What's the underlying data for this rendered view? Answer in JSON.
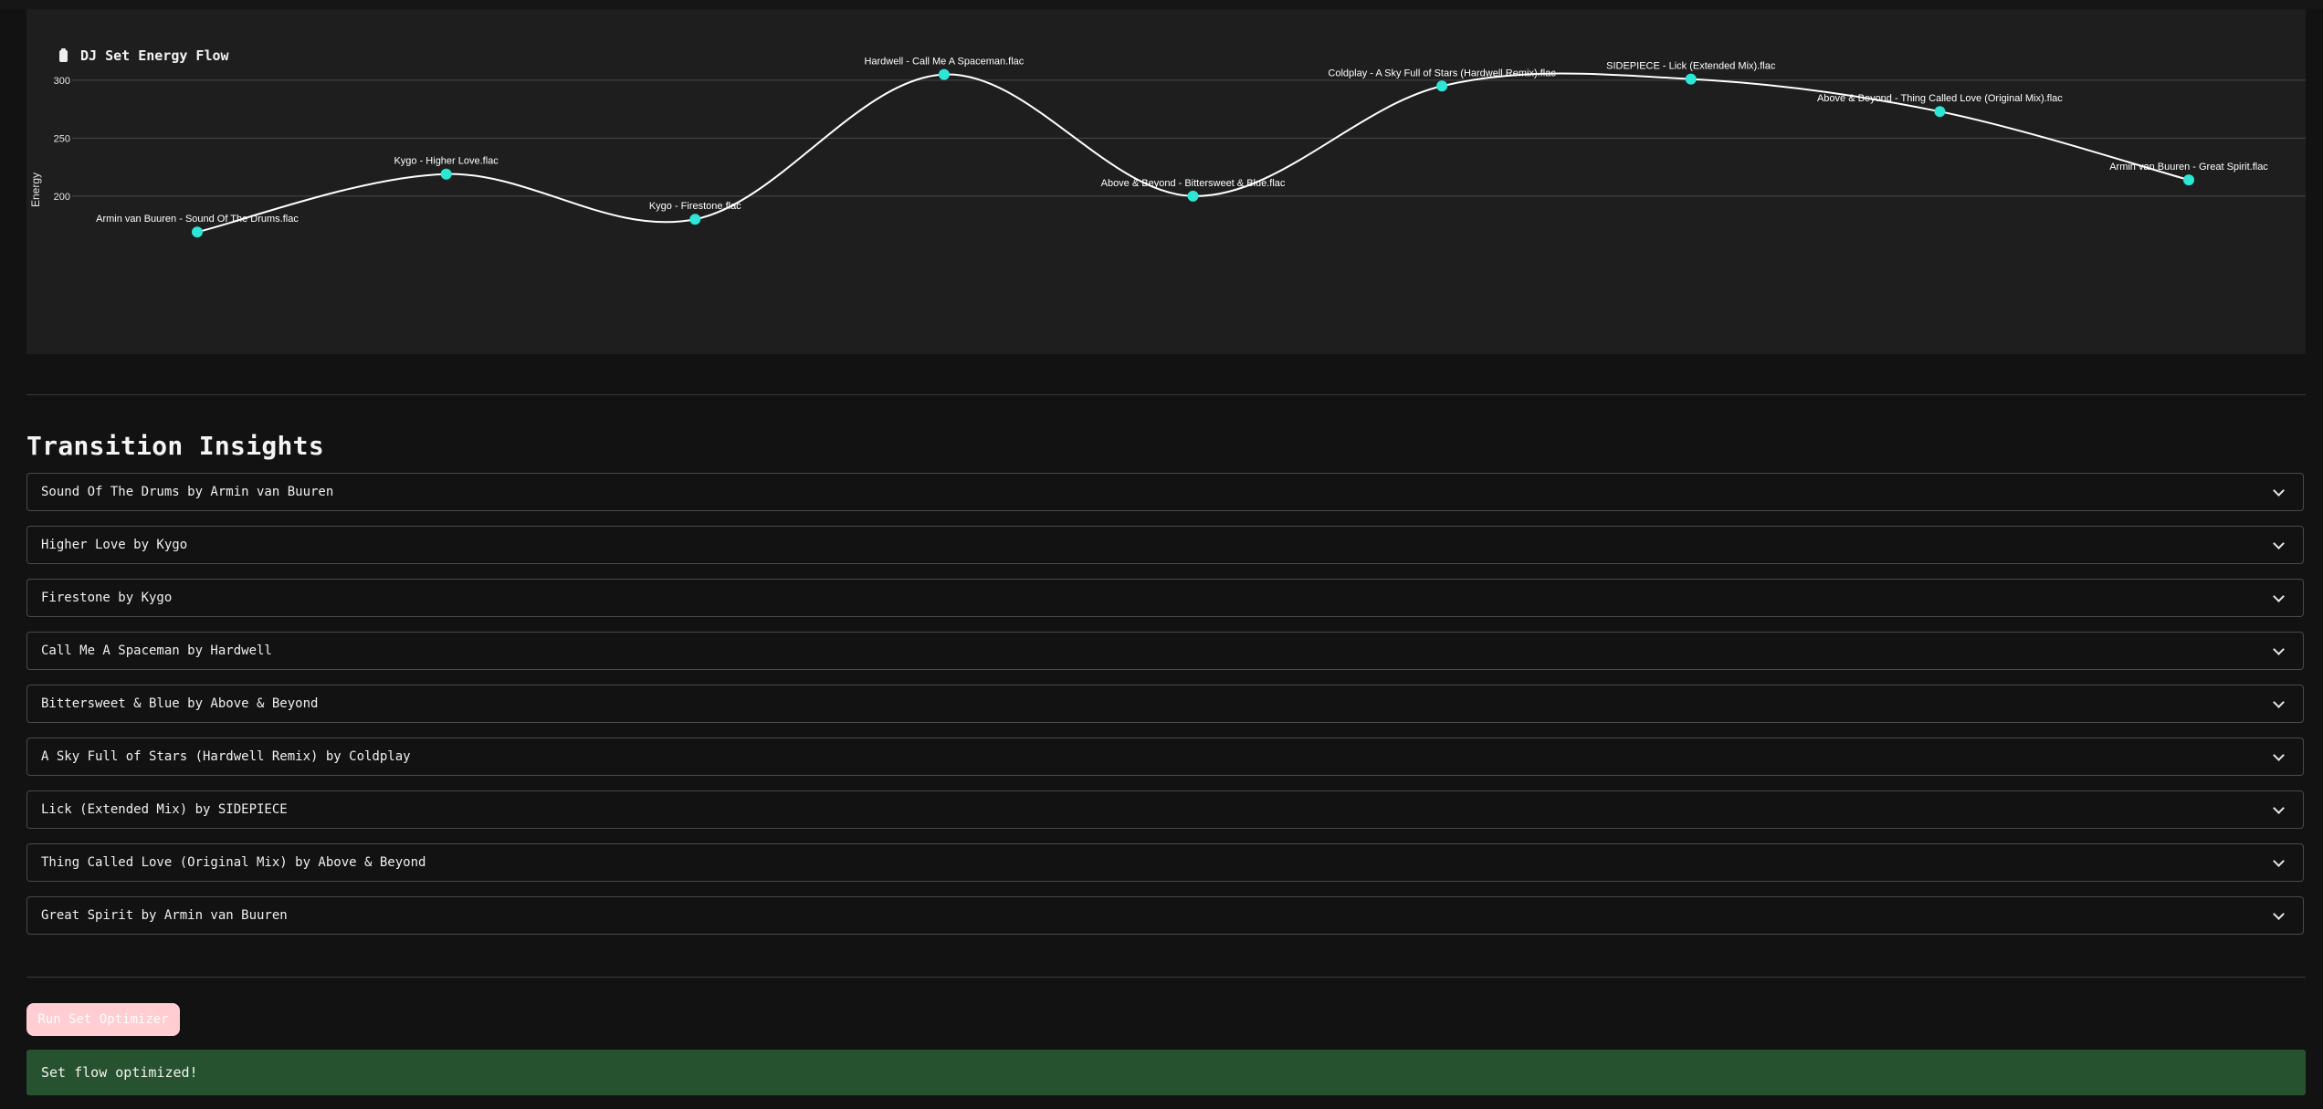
{
  "chart": {
    "title": "DJ Set Energy Flow",
    "title_icon": "clipboard-icon"
  },
  "chart_data": {
    "type": "line",
    "title": "DJ Set Energy Flow",
    "xlabel": "",
    "ylabel": "Energy",
    "yticks": [
      200,
      250,
      300
    ],
    "ylim": [
      140,
      322
    ],
    "grid": true,
    "curve": "smooth",
    "line_color": "#ffffff",
    "marker_color": "#2de6d6",
    "points": [
      {
        "label": "Armin van Buuren - Sound Of The Drums.flac",
        "y": 169
      },
      {
        "label": "Kygo - Higher Love.flac",
        "y": 219
      },
      {
        "label": "Kygo - Firestone.flac",
        "y": 180
      },
      {
        "label": "Hardwell - Call Me A Spaceman.flac",
        "y": 305
      },
      {
        "label": "Above & Beyond - Bittersweet & Blue.flac",
        "y": 200
      },
      {
        "label": "Coldplay - A Sky Full of Stars (Hardwell Remix).flac",
        "y": 295
      },
      {
        "label": "SIDEPIECE - Lick (Extended Mix).flac",
        "y": 301
      },
      {
        "label": "Above & Beyond - Thing Called Love (Original Mix).flac",
        "y": 273
      },
      {
        "label": "Armin van Buuren - Great Spirit.flac",
        "y": 214
      }
    ]
  },
  "insights": {
    "title": "Transition Insights",
    "items": [
      {
        "label": "Sound Of The Drums by Armin van Buuren"
      },
      {
        "label": "Higher Love by Kygo"
      },
      {
        "label": "Firestone by Kygo"
      },
      {
        "label": "Call Me A Spaceman by Hardwell"
      },
      {
        "label": "Bittersweet & Blue by Above & Beyond"
      },
      {
        "label": "A Sky Full of Stars (Hardwell Remix) by Coldplay"
      },
      {
        "label": "Lick (Extended Mix) by SIDEPIECE"
      },
      {
        "label": "Thing Called Love (Original Mix) by Above & Beyond"
      },
      {
        "label": "Great Spirit by Armin van Buuren"
      }
    ],
    "expand_icon": "chevron-down-icon"
  },
  "actions": {
    "run_label": "Run Set Optimizer"
  },
  "status": {
    "message": "Set flow optimized!",
    "color": "#27522f"
  }
}
